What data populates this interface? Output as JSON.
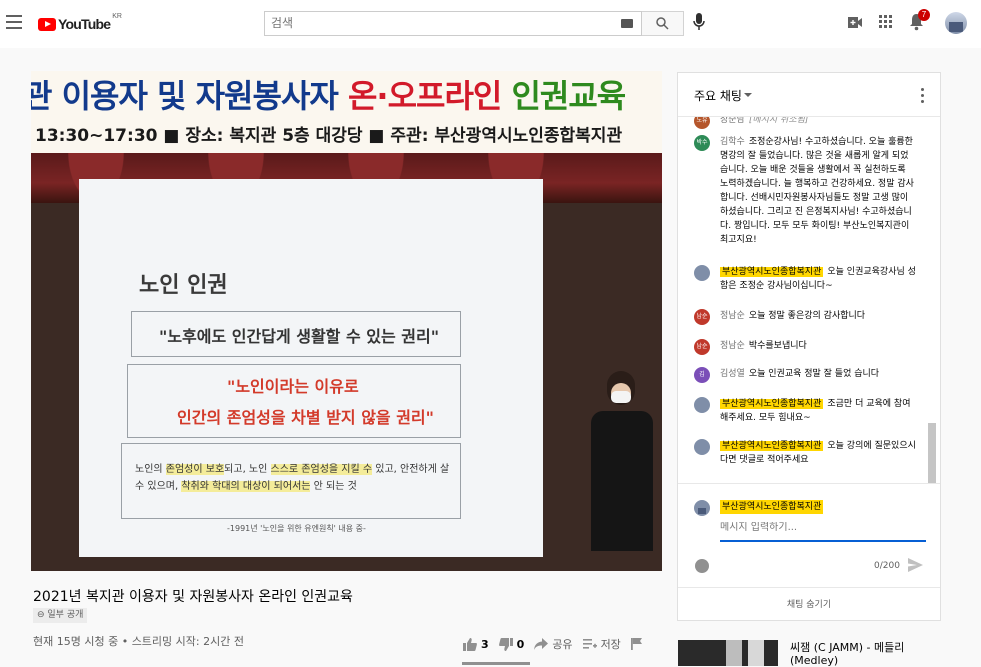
{
  "header": {
    "logo_text": "YouTube",
    "logo_region": "KR",
    "search_placeholder": "검색",
    "notification_count": "7",
    "icons": [
      "menu-icon",
      "keyboard-icon",
      "search-icon",
      "mic-icon",
      "create-video-icon",
      "apps-icon",
      "bell-icon",
      "avatar"
    ]
  },
  "video": {
    "banner_line1_a": "관 이용자 및 자원봉사자 ",
    "banner_line1_b": "온·오프라인",
    "banner_line1_c": " 인권교육",
    "banner_line2": "13:30~17:30   ■ 장소: 복지관 5층 대강당   ■ 주관: 부산광역시노인종합복지관",
    "slide_heading": "노인 인권",
    "slide_box1": "\"노후에도 인간답게 생활할 수 있는 권리\"",
    "slide_box2_l1": "\"노인이라는 이유로",
    "slide_box2_l2": "인간의 존엄성을 차별 받지 않을 권리\"",
    "slide_box3_pre": "노인의 ",
    "slide_box3_m1": "존엄성이 보호",
    "slide_box3_mid": "되고, 노인 ",
    "slide_box3_m2": "스스로 존엄성을 지킬 수",
    "slide_box3_post": " 있고, 안전하게 살 수 있으며, ",
    "slide_box3_m3": "착취와 학대의 대상이 되어서는",
    "slide_box3_end": " 안 되는 것",
    "slide_footnote": "-1991년 '노인을 위한 유엔원칙' 내용 중-"
  },
  "info": {
    "title": "2021년 복지관 이용자 및 자원봉사자 온라인 인권교육",
    "privacy": "⊖ 일부 공개",
    "meta": "현재 15명 시청 중 • 스트리밍 시작: 2시간 전",
    "likes": "3",
    "dislikes": "0",
    "share": "공유",
    "save": "저장"
  },
  "chat": {
    "title": "주요 채팅",
    "messages": [
      {
        "avatar": "노유",
        "avatar_color": "#b5562b",
        "author": "장순남",
        "text": "[메시지 취소됨]",
        "deleted": true
      },
      {
        "avatar": "박수",
        "avatar_color": "#2e8b57",
        "author": "김학수",
        "text": "조정순강사님! 수고하셨습니다. 오늘 훌륭한 명강의 잘 들었습니다. 많은 것을 새롭게 알게 되었습니다. 오늘 배운 것들을 생활에서 꼭 실천하도록 노력하겠습니다. 늘 행복하고 건강하세요. 정말 감사합니다. 선배시민자원봉사자님들도 정말 고생 많이 하셨습니다. 그리고 진 은정복지사님! 수고하셨습니다. 짱입니다. 모두 모두 화이팅! 부산노인복지관이 최고지요!"
      },
      {
        "avatar": "",
        "avatar_color": "#7f8ea8",
        "author": "부산광역시노인종합복지관",
        "owner": true,
        "text": "오늘 인권교육강사님 성함은 조정순 강사님이십니다~"
      },
      {
        "avatar": "남순",
        "avatar_color": "#c0392b",
        "author": "정남순",
        "text": "오늘 정말 좋은강의 감사합니다"
      },
      {
        "avatar": "남순",
        "avatar_color": "#c0392b",
        "author": "정남순",
        "text": "박수를보냅니다"
      },
      {
        "avatar": "김",
        "avatar_color": "#7b4fb8",
        "author": "김성열",
        "text": "오늘 인권교육 정말 잘 들었 습니다"
      },
      {
        "avatar": "",
        "avatar_color": "#7f8ea8",
        "author": "부산광역시노인종합복지관",
        "owner": true,
        "text": "조금만 더 교육에 참여해주세요. 모두 힘내요~"
      },
      {
        "avatar": "",
        "avatar_color": "#7f8ea8",
        "author": "부산광역시노인종합복지관",
        "owner": true,
        "text": "오늘 강의에 질문있으시다면 댓글로 적어주세요"
      }
    ],
    "input_author": "부산광역시노인종합복지관",
    "input_placeholder": "메시지 입력하기...",
    "counter": "0/200",
    "hide_label": "채팅 숨기기"
  },
  "recommendation": {
    "title": "씨잼 (C JAMM) - 메들리 (Medley)"
  }
}
